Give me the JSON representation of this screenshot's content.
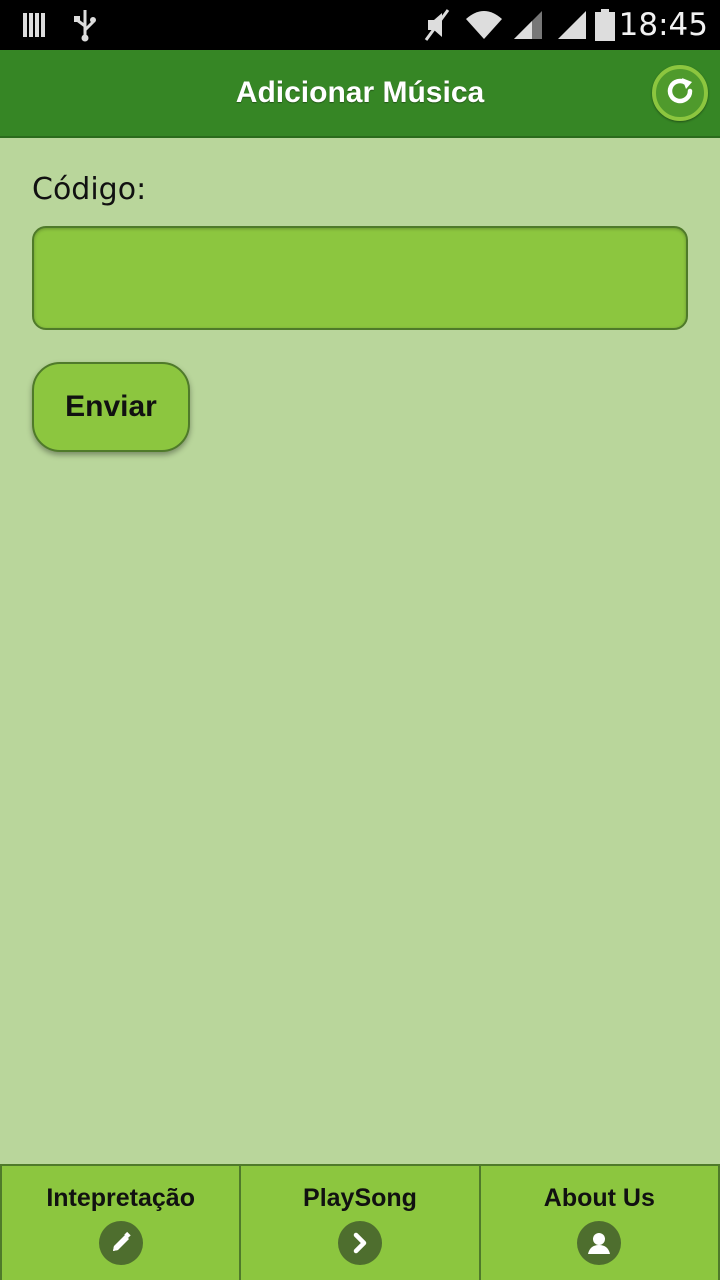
{
  "status_bar": {
    "time": "18:45",
    "icons": [
      "sim-icon",
      "usb-icon",
      "mute-icon",
      "wifi-icon",
      "signal-icon",
      "signal-icon",
      "battery-icon"
    ]
  },
  "header": {
    "title": "Adicionar Música",
    "refresh_icon": "refresh-icon"
  },
  "form": {
    "code_label": "Código:",
    "code_value": "",
    "send_label": "Enviar"
  },
  "footer": {
    "items": [
      {
        "label": "Intepretação",
        "icon": "pencil-icon"
      },
      {
        "label": "PlaySong",
        "icon": "chevron-right-icon"
      },
      {
        "label": "About Us",
        "icon": "user-icon"
      }
    ]
  },
  "colors": {
    "header_bg": "#368625",
    "page_bg": "#b9d69b",
    "accent": "#8cc63f",
    "icon_circle": "#4e6e2e"
  }
}
